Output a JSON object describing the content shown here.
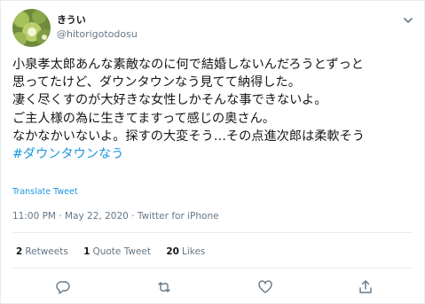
{
  "tweet": {
    "display_name": "きうい",
    "handle": "@hitorigotodosu",
    "body_lines": [
      "小泉孝太郎あんな素敵なのに何で結婚しないんだろうとずっと",
      "思ってたけど、ダウンタウンなう見てて納得した。",
      "凄く尽くすのが大好きな女性しかそんな事できないよ。",
      "ご主人様の為に生きてますって感じの奥さん。",
      "なかなかいないよ。探すの大変そう…その点進次郎は柔軟そう"
    ],
    "hashtag": "#ダウンタウンなう",
    "translate_label": "Translate Tweet",
    "meta": "11:00 PM · May 22, 2020 · Twitter for iPhone",
    "stats": {
      "retweets_count": "2",
      "retweets_label": "Retweets",
      "quote_count": "1",
      "quote_label": "Quote Tweet",
      "likes_count": "20",
      "likes_label": "Likes"
    },
    "colors": {
      "accent": "#1b95e0",
      "secondary_text": "#657786",
      "border": "#e6ecf0"
    },
    "icons": {
      "caret": "chevron-down-icon",
      "reply": "reply-icon",
      "retweet": "retweet-icon",
      "like": "heart-icon",
      "share": "share-icon"
    }
  }
}
